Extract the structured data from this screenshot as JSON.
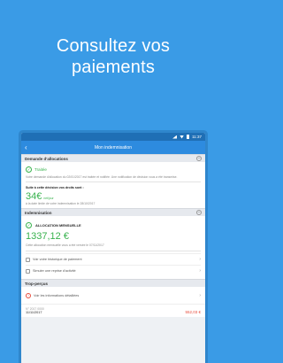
{
  "hero": {
    "line1": "Consultez vos",
    "line2": "paiements"
  },
  "statusbar": {
    "time": "11:37"
  },
  "appbar": {
    "back_icon": "arrow-left-icon",
    "title": "Mon indemnisation"
  },
  "demande": {
    "header": "Demande d'allocations",
    "status": "Traitée",
    "desc": "Votre demande d'allocation du 02/01/2017 est traitée et notifiée. Une notification de décision vous a été transmise.",
    "rights_label": "Suite à cette décision vos droits sont :",
    "daily_amount": "34€",
    "daily_unit": "net/jour",
    "daily_note": "à la date limite de votre indemnisation le 28/10/2017"
  },
  "indemnisation": {
    "header": "Indemnisation",
    "alloc_title": "ALLOCATION MENSUELLE",
    "amount": "1337,12 €",
    "desc": "Cette allocation mensuelle vous a été versée le 07/11/2017",
    "link1": "Voir votre historique de paiement",
    "link2": "Simuler une reprise d'activité"
  },
  "trop_percus": {
    "header": "Trop-perçus",
    "link": "Voir les informations détaillées",
    "ref": "N° 2017 0000",
    "date": "11/11/2017",
    "amount": "552,03 €"
  },
  "colors": {
    "background": "#3a9be6",
    "appbar": "#2d8bdf",
    "green": "#37b24d",
    "red": "#e74c3c"
  }
}
